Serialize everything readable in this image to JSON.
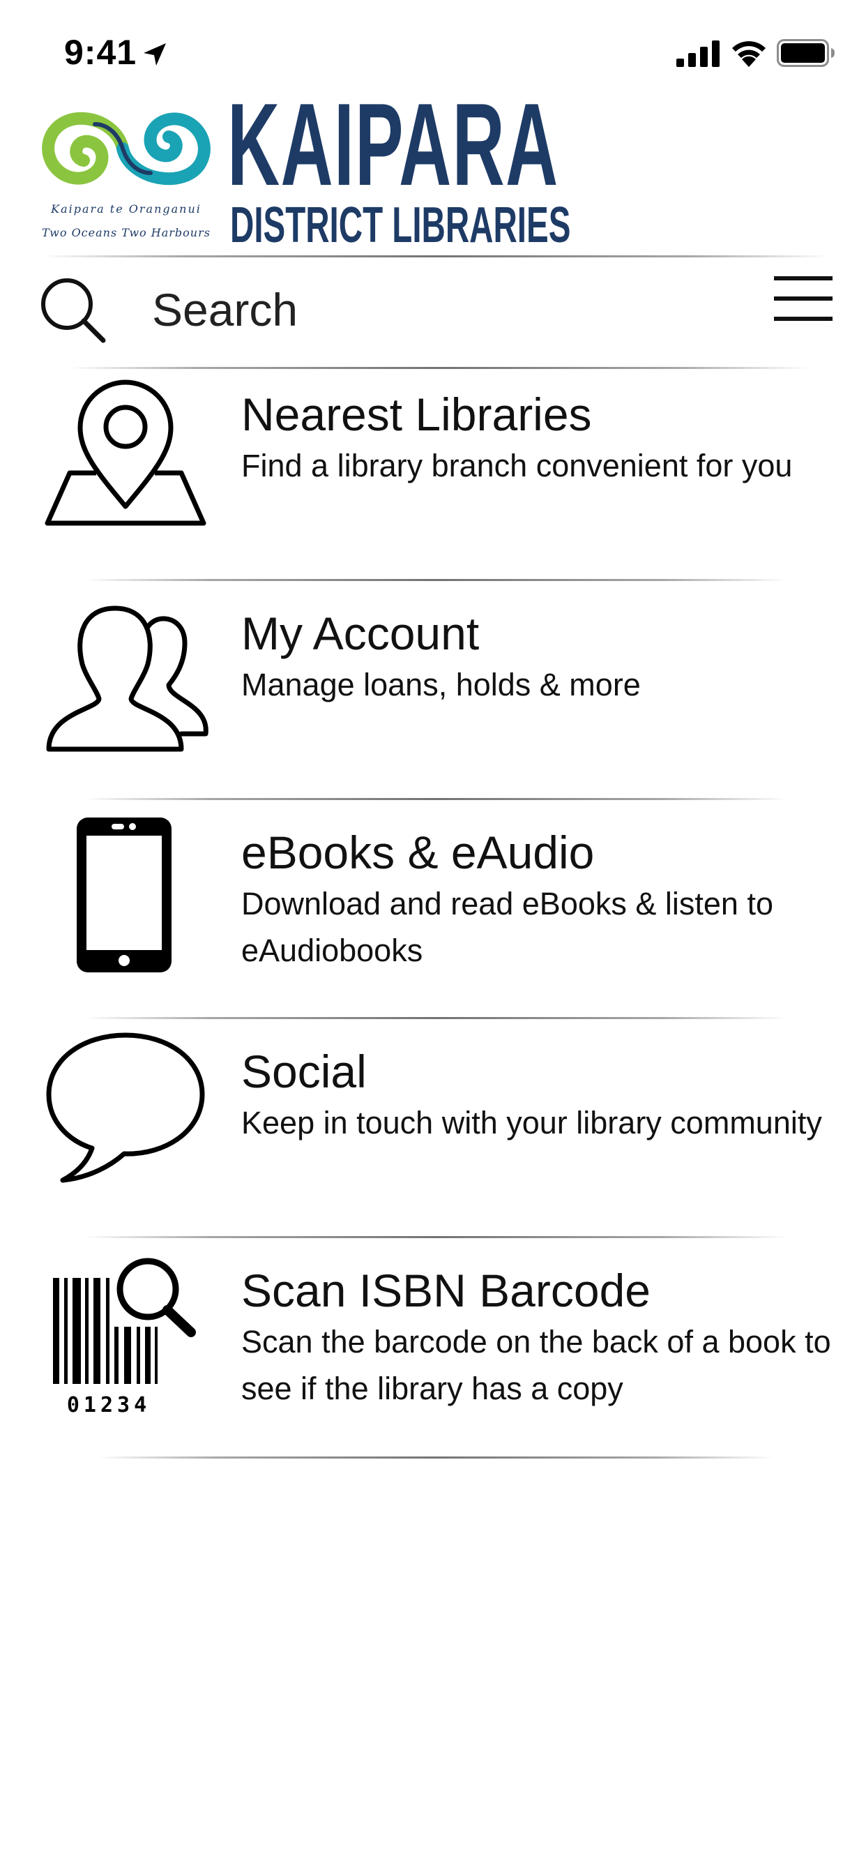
{
  "status_bar": {
    "time": "9:41"
  },
  "header": {
    "logo_name": "KAIPARA",
    "logo_subtitle": "DISTRICT LIBRARIES",
    "logo_tagline_1": "Kaipara te Oranganui",
    "logo_tagline_2": "Two Oceans Two Harbours",
    "brand_color": "#1e3b66",
    "accent_green": "#8bc53f",
    "accent_teal": "#1aa3b5"
  },
  "search": {
    "placeholder": "Search"
  },
  "menu": {
    "items": [
      {
        "title": "Nearest Libraries",
        "description": "Find a library branch convenient for you",
        "icon": "map-pin-icon"
      },
      {
        "title": "My Account",
        "description": "Manage loans, holds & more",
        "icon": "users-icon"
      },
      {
        "title": "eBooks & eAudio",
        "description": "Download and read eBooks & listen to eAudiobooks",
        "icon": "smartphone-icon"
      },
      {
        "title": "Social",
        "description": "Keep in touch with your library community",
        "icon": "speech-bubble-icon"
      },
      {
        "title": "Scan ISBN Barcode",
        "description": "Scan the barcode on the back of a book to see if the library has a copy",
        "icon": "barcode-search-icon",
        "barcode_digits": "01234"
      }
    ]
  }
}
